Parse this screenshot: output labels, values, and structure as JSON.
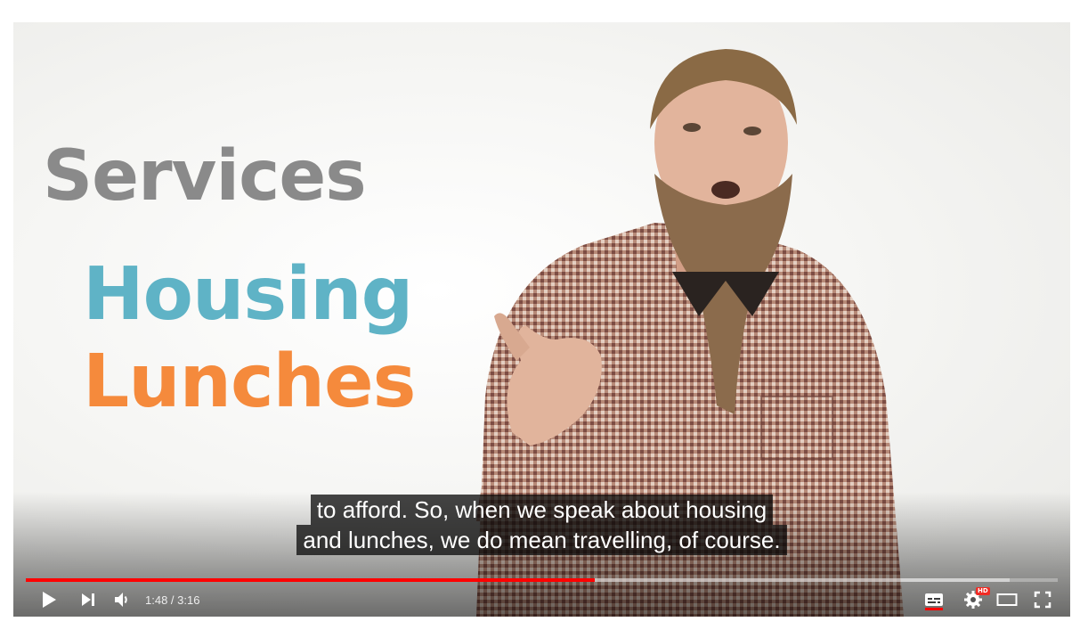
{
  "video": {
    "overlay_words": [
      "Services",
      "Housing",
      "Lunches"
    ]
  },
  "captions": {
    "line1": "to afford. So, when we speak about housing",
    "line2": "and lunches, we do mean travelling, of course."
  },
  "player": {
    "current_time": "1:48",
    "duration": "3:16",
    "time_display": "1:48 / 3:16",
    "progress_played_fraction": 0.551,
    "progress_loaded_fraction": 0.953,
    "quality_badge": "HD",
    "accent_color": "#ff0000"
  },
  "icons": {
    "play": "play-icon",
    "next": "next-icon",
    "volume": "volume-icon",
    "captions": "captions-icon",
    "settings": "settings-gear-icon",
    "theater": "theater-mode-icon",
    "fullscreen": "fullscreen-icon"
  }
}
